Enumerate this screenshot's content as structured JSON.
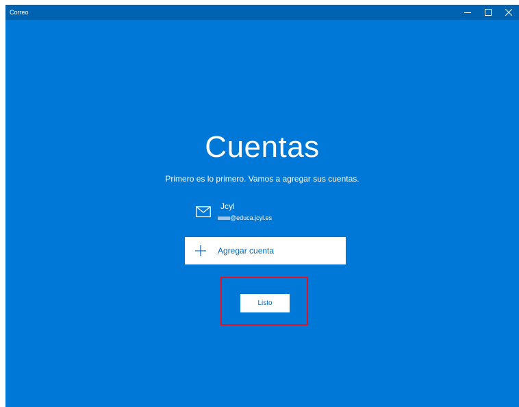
{
  "window": {
    "title": "Correo",
    "controls": {
      "minimize_icon": "minimize-icon",
      "maximize_icon": "maximize-icon",
      "close_icon": "close-icon"
    }
  },
  "main": {
    "heading": "Cuentas",
    "subtitle": "Primero es lo primero. Vamos a agregar sus cuentas.",
    "account": {
      "icon": "mail-icon",
      "name": "Jcyl",
      "email_domain": "@educa.jcyl.es"
    },
    "add_account": {
      "icon": "plus-icon",
      "label": "Agregar cuenta"
    },
    "done_button": {
      "label": "Listo"
    }
  },
  "colors": {
    "background": "#0078d7",
    "titlebar": "#0063b1",
    "button_text": "#0067c0",
    "highlight": "#e81123"
  }
}
